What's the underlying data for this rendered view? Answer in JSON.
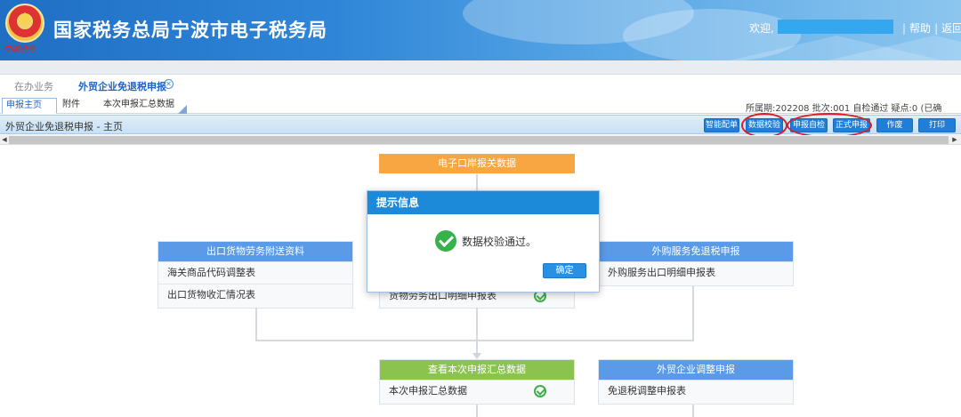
{
  "header": {
    "emblem_text": "中国税务",
    "title": "国家税务总局宁波市电子税务局",
    "welcome": "欢迎,",
    "links": [
      "帮助",
      "返回"
    ]
  },
  "main_tabs": [
    {
      "label": "在办业务"
    },
    {
      "label": "外贸企业免退税申报"
    }
  ],
  "sub_tabs": [
    {
      "label": "申报主页"
    },
    {
      "label": "附件"
    },
    {
      "label": "本次申报汇总数据"
    }
  ],
  "period_info": "所属期:202208  批次:001  自检通过  疑点:0  (已确",
  "toolbar": {
    "title": "外贸企业免退税申报 - 主页",
    "buttons": [
      "智能配单",
      "数据校验",
      "申报自检",
      "正式申报",
      "作废",
      "打印"
    ]
  },
  "flow": {
    "customs_data": "电子口岸报关数据",
    "export_attach": {
      "title": "出口货物劳务附送资料",
      "rows": [
        "海关商品代码调整表",
        "出口货物收汇情况表"
      ]
    },
    "goods_detail_row": "货物劳务出口明细申报表",
    "purchase_service": {
      "title": "外购服务免退税申报",
      "rows": [
        "外购服务出口明细申报表"
      ]
    },
    "summary": {
      "title": "查看本次申报汇总数据",
      "rows": [
        "本次申报汇总数据"
      ]
    },
    "adjust": {
      "title": "外贸企业调整申报",
      "rows": [
        "免退税调整申报表"
      ]
    }
  },
  "modal": {
    "title": "提示信息",
    "message": "数据校验通过。",
    "ok_label": "确定"
  },
  "colors": {
    "header_blue": "#1f6fc4",
    "toolbar_button": "#1f7fd8",
    "flow_blue": "#5b9ae6",
    "flow_orange": "#f8a641",
    "flow_green": "#8cc34f",
    "success_green": "#35b24a",
    "highlight_red": "#d81e2a"
  }
}
